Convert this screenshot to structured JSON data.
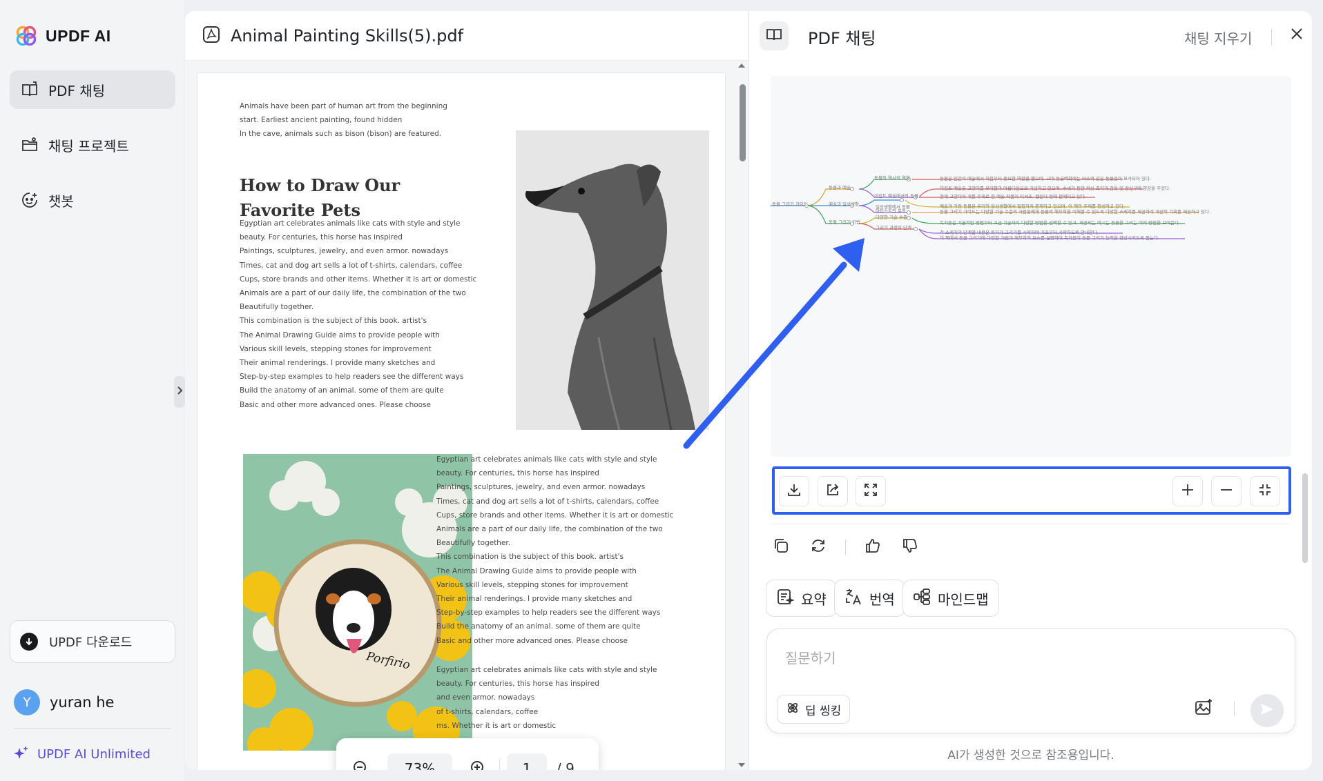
{
  "colors": {
    "accent_blue": "#2f5ff0",
    "brand_purple": "#5b4bd6",
    "avatar_blue": "#5aa2f0"
  },
  "sidebar": {
    "app_name": "UPDF AI",
    "nav": [
      {
        "label": "PDF 채팅",
        "icon": "book-chat-icon",
        "active": true
      },
      {
        "label": "채팅 프로젝트",
        "icon": "folder-icon",
        "active": false
      },
      {
        "label": "챗봇",
        "icon": "bot-icon",
        "active": false
      }
    ],
    "download_label": "UPDF 다운로드",
    "user": {
      "initial": "Y",
      "name": "yuran he"
    },
    "plan_label": "UPDF AI Unlimited"
  },
  "viewer": {
    "file_name": "Animal Painting Skills(5).pdf",
    "intro_lines": [
      "Animals have been part of human art from the beginning",
      "start. Earliest ancient painting, found hidden",
      "In the cave, animals such as bison (bison) are featured."
    ],
    "heading_lines": [
      "How to Draw Our",
      "Favorite Pets"
    ],
    "body_lines": [
      "Egyptian art celebrates animals like cats with style and style",
      "beauty. For centuries, this horse has inspired",
      "Paintings, sculptures, jewelry, and even armor. nowadays",
      "Times, cat and dog art sells a lot of t-shirts, calendars, coffee",
      "Cups, store brands and other items. Whether it is art or domestic",
      "Animals are a part of our daily life, the combination of the two",
      "Beautifully together.",
      "This combination is the subject of this book. artist's",
      "The Animal Drawing Guide aims to provide people with",
      "Various skill levels, stepping stones for improvement",
      "Their animal renderings. I provide many sketches and",
      "Step-by-step examples to help readers see the different ways",
      "Build the anatomy of an animal. some of them are quite",
      "Basic and other more advanced ones. Please choose"
    ],
    "right_body_lines": [
      "Egyptian art celebrates animals like cats with style and style",
      "beauty. For centuries, this horse has inspired",
      "Paintings, sculptures, jewelry, and even armor. nowadays",
      "Times, cat and dog art sells a lot of t-shirts, calendars, coffee",
      "Cups, store brands and other items. Whether it is art or domestic",
      "Animals are a part of our daily life, the combination of the two",
      "Beautifully together.",
      "This combination is the subject of this book. artist's",
      "The Animal Drawing Guide aims to provide people with",
      "Various skill levels, stepping stones for improvement",
      "Their animal renderings. I provide many sketches and",
      "Step-by-step examples to help readers see the different ways",
      "Build the anatomy of an animal. some of them are quite",
      "Basic and other more advanced ones. Please choose"
    ],
    "right_body_lines_2": [
      "Egyptian art celebrates animals like cats with style and style",
      "beauty. For centuries, this horse has inspired",
      "and even armor. nowadays",
      "of t-shirts, calendars, coffee",
      "ms. Whether it is art or domestic"
    ],
    "photo_caption": "Porfirio",
    "zoom_level": "73%",
    "current_page": "1",
    "total_pages": "/ 9"
  },
  "chat": {
    "title": "PDF 채팅",
    "clear_label": "채팅 지우기",
    "mindmap": {
      "root": "동물 그리기 가이드",
      "branches": [
        {
          "label": "동물과 예술",
          "children": [
            "동물의 역사적 역할",
            "이집트 예술에서의 동물"
          ]
        },
        {
          "label": "예술과 일상생활",
          "children": [
            "일상생활에서 동물",
            "아티스트의 목표"
          ]
        },
        {
          "label": "동물 그리기 기법",
          "children": [
            "다양한 기술 수준",
            "그리기 과정의 단계"
          ]
        }
      ],
      "leaves": [
        "동물은 인간의 예술에서 처음부터 중요한 역할을 했으며, 고대 동굴벽화에는 바소와 같은 동물들이 묘사되어 있다.",
        "이집트 예술은 고양이를 우아함과 아름다움으로 기념하고 있으며, 수세기 동안 혁신 조각과 갑옷 및 장신구에 영감을 주었다.",
        "현재 고양이와 개를 주제로 한 예술 작품이 티셔츠, 캘린더 등에 판매되고 있다.",
        "예술과 가정 동물은 우리의 일상생활에서 밀접하게 존재하고 있으며, 이 책의 주제를 형성하고 있다.",
        "동물 그리기 가이드는 다양한 기술 수준의 사람들에게 동물의 해부학을 이해할 수 있도록 다양한 스케치를 제공하며 개선의 기회를 제공하고 있다.",
        "독자들은 기본적인 방법부터 고급 기술까지 다양한 방법을 선택할 수 있고, 제공되는 예시는 동물을 그리는 여러 방법을 보여준다.",
        "각 스케치의 단계별 내용은 독자가 그리기를 시작하며 기초부터 시작하도록 안내한다.",
        "이 책에서 동물 그리기에 다양한 기법과 해부학적 요소를 설명하여 독자들이 동물 그리기 능력을 향상시키도록 돕는다."
      ]
    },
    "toolbar_icons": [
      "download-icon",
      "share-icon",
      "fullscreen-icon",
      "zoom-in-icon",
      "zoom-out-icon",
      "fit-icon"
    ],
    "actions": [
      {
        "label": "요약",
        "icon": "summary-icon"
      },
      {
        "label": "번역",
        "icon": "translate-icon"
      },
      {
        "label": "마인드맵",
        "icon": "mindmap-icon"
      }
    ],
    "input_placeholder": "질문하기",
    "deep_thinking_label": "딥 씽킹",
    "disclaimer": "AI가 생성한 것으로 참조용입니다."
  }
}
